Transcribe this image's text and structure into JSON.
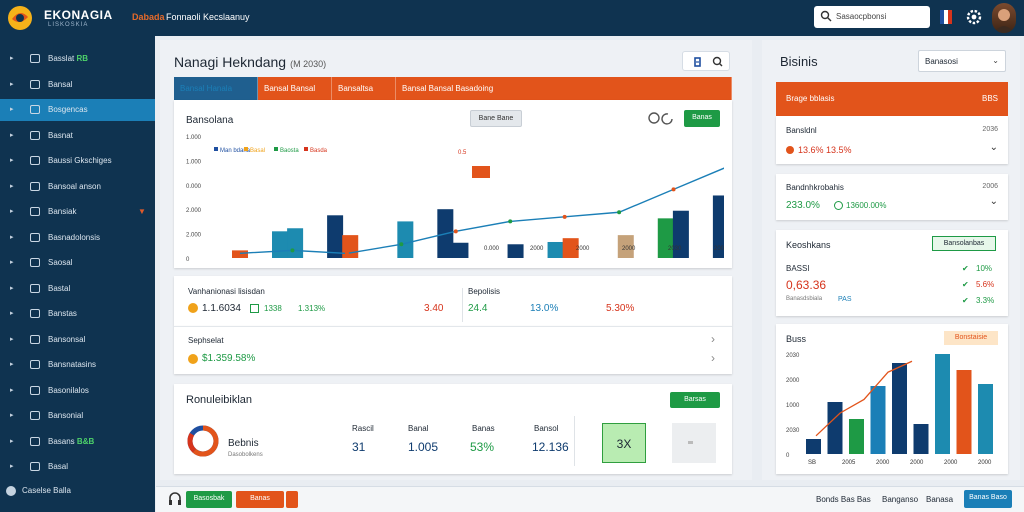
{
  "header": {
    "brand": "EKONAGIA",
    "brand_sub": "LISKOSKIA",
    "tag": "Dabada",
    "title": "Fonnaoli Kecslaanuy",
    "search_text": "Sasaocpbonsi"
  },
  "sidebar": {
    "items": [
      {
        "label": "Basslat",
        "badge": "RB",
        "active": false,
        "arrow": false
      },
      {
        "label": "Bansal",
        "badge": "",
        "active": false,
        "arrow": false
      },
      {
        "label": "Bosgencas",
        "badge": "",
        "active": true,
        "arrow": false
      },
      {
        "label": "Basnat",
        "badge": "",
        "active": false,
        "arrow": false
      },
      {
        "label": "Baussi Gkschiges",
        "badge": "",
        "active": false,
        "arrow": false
      },
      {
        "label": "Bansoal anson",
        "badge": "",
        "active": false,
        "arrow": false
      },
      {
        "label": "Bansiak",
        "badge": "",
        "active": false,
        "arrow": true
      },
      {
        "label": "Basnadolonsis",
        "badge": "",
        "active": false,
        "arrow": false
      },
      {
        "label": "Saosal",
        "badge": "",
        "active": false,
        "arrow": false
      },
      {
        "label": "Bastal",
        "badge": "",
        "active": false,
        "arrow": false
      },
      {
        "label": "Banstas",
        "badge": "",
        "active": false,
        "arrow": false
      },
      {
        "label": "Bansonsal",
        "badge": "",
        "active": false,
        "arrow": false
      },
      {
        "label": "Bansnatasins",
        "badge": "",
        "active": false,
        "arrow": false
      },
      {
        "label": "Basonilalos",
        "badge": "",
        "active": false,
        "arrow": false
      },
      {
        "label": "Bansonial",
        "badge": "",
        "active": false,
        "arrow": false
      },
      {
        "label": "Basans",
        "badge": "B&B",
        "active": false,
        "arrow": false
      },
      {
        "label": "Basal",
        "badge": "",
        "active": false,
        "arrow": false
      }
    ],
    "footer": "Caselse Balla"
  },
  "main": {
    "title": "Nanagi Hekndang",
    "title_meta": "(M 2030)",
    "tabs": [
      "Bansal Hanala",
      "Bansal Bansal",
      "Bansaltsa",
      "Bansal Bansal Basadoing"
    ],
    "chart_heading": "Bansolana",
    "chart_pill": "Bane Bane",
    "chart_btn": "Banas"
  },
  "chart_data": {
    "type": "bar",
    "categories": [
      "2020",
      "2030",
      "2030",
      "2000",
      "2000",
      "2030"
    ],
    "legend": [
      "Man bdana",
      "Basal",
      "Baosta",
      "Basda"
    ],
    "ylim": [
      0,
      1600
    ],
    "y_ticks": [
      "0",
      "2.000",
      "2.000",
      "0.000",
      "1.000",
      "1.000"
    ],
    "x_labels": [
      "0.000",
      "2000",
      "2000",
      "2000",
      "2030",
      "2000"
    ],
    "annotation": "0.5",
    "series": [
      {
        "name": "Basal",
        "values": [
          100,
          390,
          300,
          480,
          200,
          180,
          260,
          300,
          620
        ]
      },
      {
        "name": "Basda",
        "values": [
          350,
          560,
          0,
          640,
          0,
          210,
          0,
          520,
          820
        ]
      }
    ],
    "line": [
      60,
      100,
      60,
      180,
      350,
      480,
      540,
      600,
      900,
      1200
    ]
  },
  "stats": {
    "label1": "Vanhanionasi lisisdan",
    "val1": "1.1.6034",
    "val2": "1338",
    "val3": "1.313%",
    "val4": "3.40",
    "label2": "Bepolisis",
    "val5": "24.4",
    "val6": "13.0%",
    "val7": "5.30%",
    "row2_label": "Sephselat",
    "row2_val": "$1.359.58%"
  },
  "analysis": {
    "title": "Ronuleibiklan",
    "btn": "Barsas",
    "donut_title": "Bebnis",
    "donut_sub": "Dasobolkens",
    "cols": [
      {
        "label": "Rascil",
        "value": "31"
      },
      {
        "label": "Banal",
        "value": "1.005"
      },
      {
        "label": "Banas",
        "value": "53%"
      },
      {
        "label": "Bansol",
        "value": "12.136"
      }
    ],
    "x_box": "3X"
  },
  "right": {
    "title": "Bisinis",
    "select": "Banasosi",
    "head_label": "Brage bblasis",
    "head_val": "BBS",
    "c1_label": "Bansldnl",
    "c1_meta": "2036",
    "c1_val": "13.6% 13.5%",
    "c2_label": "Bandnhkrobahis",
    "c2_meta": "2006",
    "c2_val1": "233.0%",
    "c2_val2": "13600.00%",
    "c3_title": "Keoshkans",
    "c3_btn": "Bansolanbas",
    "c3_sub": "BASSI",
    "c3_big": "0,63.36",
    "c3_foot": "Banasdsbiala",
    "c3_foot_val": "PAS",
    "c3_pcts": [
      "10%",
      "5.6%",
      "3.3%"
    ],
    "c4_title": "Buss",
    "c4_badge": "Bonstaisie",
    "c4_y": [
      "2030",
      "2000",
      "1000",
      "2030",
      "0"
    ],
    "c4_x": [
      "SB",
      "2005",
      "2000",
      "2000",
      "2000",
      "2000"
    ],
    "c4_values": [
      15,
      52,
      35,
      68,
      91,
      30,
      100,
      84,
      70
    ],
    "c4_line": [
      20,
      45,
      60,
      90,
      102
    ]
  },
  "bottom": {
    "btn1": "Basosbak",
    "btn2": "Banas",
    "links": [
      "Bonds Bas Bas",
      "Banganso",
      "Banasa"
    ],
    "btn_right": "Banas Baso"
  },
  "colors": {
    "nav": "#0f3350",
    "active": "#1b7fb7",
    "orange": "#e2541b",
    "green": "#1e9a45",
    "navy": "#0e3b6e",
    "teal": "#1d8bb0"
  }
}
